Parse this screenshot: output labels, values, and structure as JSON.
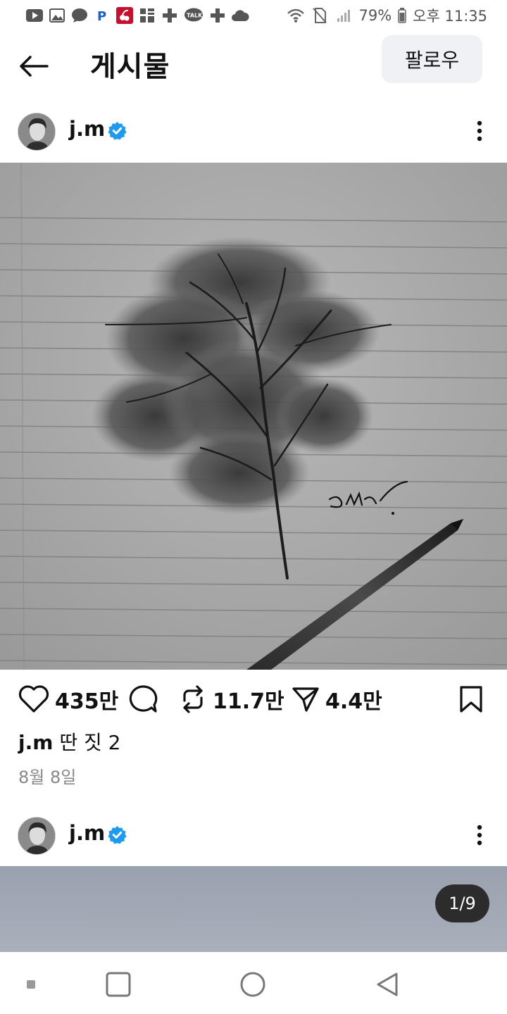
{
  "status_bar": {
    "battery": "79%",
    "time": "오후 11:35",
    "notif_talk": "TALK"
  },
  "header": {
    "title": "게시물",
    "follow_label": "팔로우"
  },
  "posts": [
    {
      "username": "j.m",
      "verified": true,
      "likes": "435만",
      "reposts": "11.7만",
      "shares": "4.4만",
      "caption_user": "j.m",
      "caption_text": "딴 짓 2",
      "date": "8월 8일"
    },
    {
      "username": "j.m",
      "verified": true,
      "carousel_counter": "1/9"
    }
  ],
  "colors": {
    "verified": "#1d9bf0",
    "follow_bg": "#eff1f4",
    "date": "#888888"
  },
  "icons": [
    "back-arrow-icon",
    "heart-icon",
    "comment-icon",
    "repost-icon",
    "send-icon",
    "bookmark-icon",
    "more-icon",
    "verified-icon"
  ]
}
